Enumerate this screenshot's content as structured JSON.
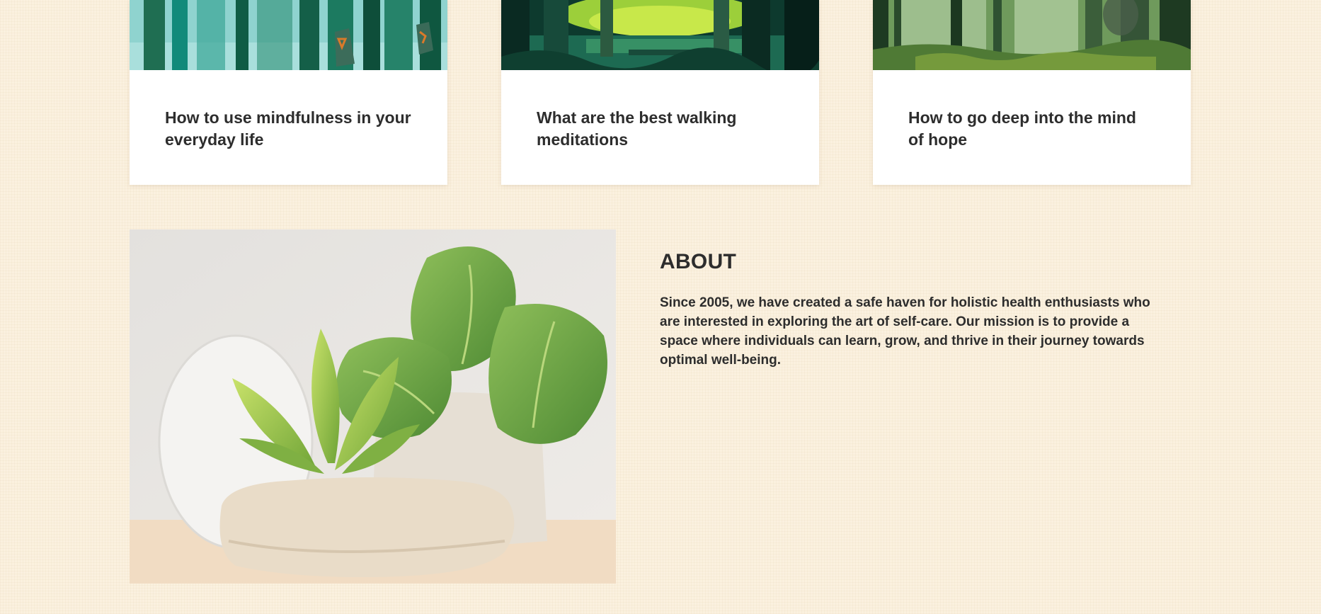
{
  "blog_cards": [
    {
      "title": "How to use mindfulness in your everyday life",
      "image": "teal-forest-illustration"
    },
    {
      "title": "What are the best walking meditations",
      "image": "jungle-swamp-illustration"
    },
    {
      "title": "How to go deep into the mind of hope",
      "image": "sunlit-forest-illustration"
    }
  ],
  "about": {
    "heading": "ABOUT",
    "body": "Since 2005, we have created a safe haven for holistic health enthusiasts who are interested in exploring the art of self-care. Our mission is to provide a space where individuals can learn, grow, and thrive in their journey towards optimal well-being.",
    "image": "monstera-plant-on-stone-podium"
  },
  "colors": {
    "page_background": "#fbf1df",
    "card_background": "#ffffff",
    "text": "#2d2d2d"
  }
}
